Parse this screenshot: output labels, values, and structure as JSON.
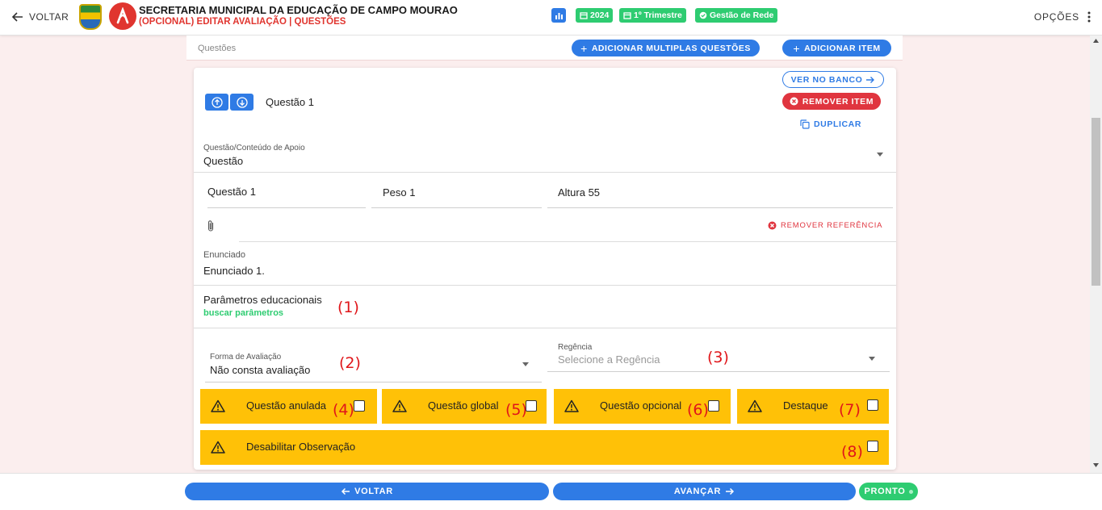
{
  "header": {
    "back_label": "VOLTAR",
    "title": "SECRETARIA MUNICIPAL DA EDUCAÇÃO DE CAMPO MOURAO",
    "subtitle": "(OPCIONAL) EDITAR AVALIAÇÃO | QUESTÕES",
    "chips": [
      {
        "label": "2024",
        "icon": "calendar-icon"
      },
      {
        "label": "1º Trimestre",
        "icon": "calendar-icon"
      },
      {
        "label": "Gestão de Rede",
        "icon": "check-circle-icon"
      }
    ],
    "options_label": "OPÇÕES"
  },
  "panel": {
    "section_label": "Questões",
    "add_multiple_label": "ADICIONAR MULTIPLAS QUESTÕES",
    "add_item_label": "ADICIONAR ITEM"
  },
  "question": {
    "title": "Questão 1",
    "view_bank_label": "VER NO BANCO",
    "remove_item_label": "REMOVER ITEM",
    "duplicate_label": "DUPLICAR",
    "support_type_label": "Questão/Conteúdo de Apoio",
    "support_type_value": "Questão",
    "name_value": "Questão 1",
    "peso_value": "Peso  1",
    "altura_value": "Altura  55",
    "remove_reference_label": "REMOVER REFERÊNCIA",
    "enunciado_label": "Enunciado",
    "enunciado_value": "Enunciado 1.",
    "params_title": "Parâmetros educacionais",
    "params_link": "buscar parâmetros",
    "forma_label": "Forma de Avaliação",
    "forma_value": "Não consta avaliação",
    "regencia_label": "Regência",
    "regencia_placeholder": "Selecione a Regência"
  },
  "flags": [
    {
      "label": "Questão anulada",
      "annotation": "(4)",
      "checked": false
    },
    {
      "label": "Questão global",
      "annotation": "(5)",
      "checked": false
    },
    {
      "label": "Questão opcional",
      "annotation": "(6)",
      "checked": false
    },
    {
      "label": "Destaque",
      "annotation": "(7)",
      "checked": false
    }
  ],
  "flag_observacao": {
    "label": "Desabilitar Observação",
    "annotation": "(8)",
    "checked": false
  },
  "annotations": {
    "a1": "(1)",
    "a2": "(2)",
    "a3": "(3)"
  },
  "footer": {
    "back_label": "VOLTAR",
    "next_label": "AVANÇAR",
    "done_label": "PRONTO"
  },
  "colors": {
    "primary": "#2f7be5",
    "success": "#2ecc71",
    "danger": "#e0353f",
    "warning": "#ffc107",
    "annotation": "#e0161a"
  }
}
